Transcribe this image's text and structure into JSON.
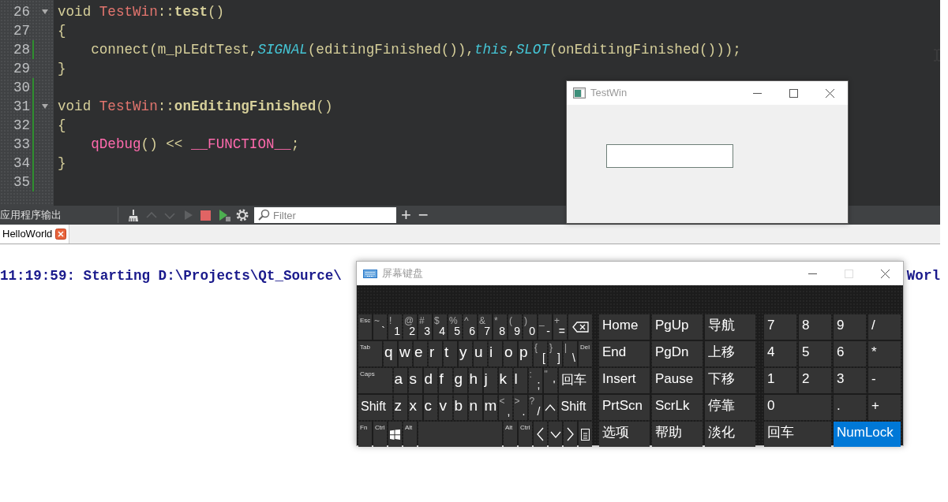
{
  "editor": {
    "lines": [
      {
        "number": "26",
        "foldable": true,
        "changed": false,
        "tokens": [
          {
            "kind": "keyword",
            "text": "void "
          },
          {
            "kind": "class",
            "text": "TestWin"
          },
          {
            "kind": "plain",
            "text": "::"
          },
          {
            "kind": "definition",
            "text": "test"
          },
          {
            "kind": "plain",
            "text": "()"
          }
        ]
      },
      {
        "number": "27",
        "foldable": false,
        "changed": false,
        "tokens": [
          {
            "kind": "plain",
            "text": "{"
          }
        ]
      },
      {
        "number": "28",
        "foldable": false,
        "changed": true,
        "tokens": [
          {
            "kind": "plain",
            "text": "    connect(m_pLEdtTest,"
          },
          {
            "kind": "macro",
            "text": "SIGNAL"
          },
          {
            "kind": "plain",
            "text": "(editingFinished()),"
          },
          {
            "kind": "macro",
            "text": "this"
          },
          {
            "kind": "plain",
            "text": ","
          },
          {
            "kind": "macro",
            "text": "SLOT"
          },
          {
            "kind": "plain",
            "text": "(onEditingFinished()));"
          }
        ]
      },
      {
        "number": "29",
        "foldable": false,
        "changed": false,
        "tokens": [
          {
            "kind": "plain",
            "text": "}"
          }
        ]
      },
      {
        "number": "30",
        "foldable": false,
        "changed": true
      },
      {
        "number": "31",
        "foldable": true,
        "changed": true,
        "tokens": [
          {
            "kind": "keyword",
            "text": "void "
          },
          {
            "kind": "class",
            "text": "TestWin"
          },
          {
            "kind": "plain",
            "text": "::"
          },
          {
            "kind": "definition",
            "text": "onEditingFinished"
          },
          {
            "kind": "plain",
            "text": "()"
          }
        ]
      },
      {
        "number": "32",
        "foldable": false,
        "changed": true,
        "tokens": [
          {
            "kind": "plain",
            "text": "{"
          }
        ]
      },
      {
        "number": "33",
        "foldable": false,
        "changed": true,
        "tokens": [
          {
            "kind": "call",
            "text": "    qDebug"
          },
          {
            "kind": "plain",
            "text": "() << "
          },
          {
            "kind": "call",
            "text": "__FUNCTION__"
          },
          {
            "kind": "plain",
            "text": ";"
          }
        ]
      },
      {
        "number": "34",
        "foldable": false,
        "changed": true,
        "tokens": [
          {
            "kind": "plain",
            "text": "}"
          }
        ]
      },
      {
        "number": "35",
        "foldable": false,
        "changed": true
      }
    ]
  },
  "output_toolbar": {
    "title": "应用程序输出",
    "buttons": [
      {
        "kind": "clean",
        "disabled": false
      },
      {
        "kind": "previous",
        "disabled": true
      },
      {
        "kind": "next",
        "disabled": true
      },
      {
        "kind": "run",
        "disabled": true
      },
      {
        "kind": "stop",
        "disabled": false
      },
      {
        "kind": "rerun",
        "disabled": false
      },
      {
        "kind": "settings",
        "disabled": false
      }
    ],
    "filter": {
      "placeholder": "Filter"
    },
    "zoom_in": "+",
    "zoom_out": "−"
  },
  "output_tabs": [
    {
      "label": "HelloWorld",
      "selected": true
    }
  ],
  "output_line": {
    "visible_start": "11:19:59: Starting D:\\Projects\\Qt_Source\\",
    "visible_end": "Worl"
  },
  "test_window": {
    "title": "TestWin"
  },
  "keyboard_window": {
    "title": "屏幕键盘",
    "maximize_disabled": true,
    "main_rows": [
      [
        {
          "kind": "function",
          "label": "Esc"
        },
        {
          "kind": "symbol",
          "shift": "~",
          "label": "`"
        },
        {
          "kind": "symbol",
          "shift": "!",
          "label": "1"
        },
        {
          "kind": "symbol",
          "shift": "@",
          "label": "2"
        },
        {
          "kind": "symbol",
          "shift": "#",
          "label": "3"
        },
        {
          "kind": "symbol",
          "shift": "$",
          "label": "4"
        },
        {
          "kind": "symbol",
          "shift": "%",
          "label": "5"
        },
        {
          "kind": "symbol",
          "shift": "^",
          "label": "6"
        },
        {
          "kind": "symbol",
          "shift": "&",
          "label": "7"
        },
        {
          "kind": "symbol",
          "shift": "*",
          "label": "8"
        },
        {
          "kind": "symbol",
          "shift": "(",
          "label": "9"
        },
        {
          "kind": "symbol",
          "shift": ")",
          "label": "0"
        },
        {
          "kind": "symbol",
          "shift": "_",
          "label": "-"
        },
        {
          "kind": "symbol",
          "shift": "+",
          "label": "="
        },
        {
          "kind": "backspace",
          "wide": true
        }
      ],
      [
        {
          "kind": "function",
          "label": "Tab",
          "wide": true
        },
        {
          "kind": "letter",
          "label": "q"
        },
        {
          "kind": "letter",
          "label": "w"
        },
        {
          "kind": "letter",
          "label": "e"
        },
        {
          "kind": "letter",
          "label": "r"
        },
        {
          "kind": "letter",
          "label": "t"
        },
        {
          "kind": "letter",
          "label": "y"
        },
        {
          "kind": "letter",
          "label": "u"
        },
        {
          "kind": "letter",
          "label": "i"
        },
        {
          "kind": "letter",
          "label": "o"
        },
        {
          "kind": "letter",
          "label": "p"
        },
        {
          "kind": "symbol",
          "shift": "{",
          "label": "["
        },
        {
          "kind": "symbol",
          "shift": "}",
          "label": "]"
        },
        {
          "kind": "symbol",
          "shift": "|",
          "label": "\\"
        },
        {
          "kind": "function",
          "label": "Del"
        }
      ],
      [
        {
          "kind": "function",
          "label": "Caps",
          "wide": true
        },
        {
          "kind": "letter",
          "label": "a"
        },
        {
          "kind": "letter",
          "label": "s"
        },
        {
          "kind": "letter",
          "label": "d"
        },
        {
          "kind": "letter",
          "label": "f"
        },
        {
          "kind": "letter",
          "label": "g"
        },
        {
          "kind": "letter",
          "label": "h"
        },
        {
          "kind": "letter",
          "label": "j"
        },
        {
          "kind": "letter",
          "label": "k"
        },
        {
          "kind": "letter",
          "label": "l"
        },
        {
          "kind": "symbol",
          "shift": ":",
          "label": ";"
        },
        {
          "kind": "symbol",
          "shift": "\"",
          "label": "'"
        },
        {
          "kind": "word",
          "label": "回车",
          "wide": true
        }
      ],
      [
        {
          "kind": "word",
          "label": "Shift",
          "wide": true
        },
        {
          "kind": "letter",
          "label": "z"
        },
        {
          "kind": "letter",
          "label": "x"
        },
        {
          "kind": "letter",
          "label": "c"
        },
        {
          "kind": "letter",
          "label": "v"
        },
        {
          "kind": "letter",
          "label": "b"
        },
        {
          "kind": "letter",
          "label": "n"
        },
        {
          "kind": "letter",
          "label": "m"
        },
        {
          "kind": "symbol",
          "shift": "<",
          "label": ","
        },
        {
          "kind": "symbol",
          "shift": ">",
          "label": "."
        },
        {
          "kind": "symbol",
          "shift": "?",
          "label": "/"
        },
        {
          "kind": "arrow-up"
        },
        {
          "kind": "word",
          "label": "Shift",
          "wide": true
        }
      ],
      [
        {
          "kind": "function",
          "label": "Fn"
        },
        {
          "kind": "function",
          "label": "Ctrl"
        },
        {
          "kind": "windows"
        },
        {
          "kind": "function",
          "label": "Alt"
        },
        {
          "kind": "space",
          "wide": true
        },
        {
          "kind": "function",
          "label": "Alt"
        },
        {
          "kind": "function",
          "label": "Ctrl"
        },
        {
          "kind": "arrow-left"
        },
        {
          "kind": "arrow-down"
        },
        {
          "kind": "arrow-right"
        },
        {
          "kind": "menu"
        }
      ]
    ],
    "nav_keys": [
      {
        "label": "Home"
      },
      {
        "label": "PgUp"
      },
      {
        "label": "导航"
      },
      {
        "label": "End"
      },
      {
        "label": "PgDn"
      },
      {
        "label": "上移"
      },
      {
        "label": "Insert"
      },
      {
        "label": "Pause"
      },
      {
        "label": "下移"
      },
      {
        "label": "PrtScn"
      },
      {
        "label": "ScrLk"
      },
      {
        "label": "停靠"
      },
      {
        "label": "选项"
      },
      {
        "label": "帮助"
      },
      {
        "label": "淡化"
      }
    ],
    "numpad_keys": [
      {
        "label": "7",
        "on": false
      },
      {
        "label": "8",
        "on": false
      },
      {
        "label": "9",
        "on": false
      },
      {
        "label": "/",
        "on": false
      },
      {
        "label": "4",
        "on": false
      },
      {
        "label": "5",
        "on": false
      },
      {
        "label": "6",
        "on": false
      },
      {
        "label": "*",
        "on": false
      },
      {
        "label": "1",
        "on": false
      },
      {
        "label": "2",
        "on": false
      },
      {
        "label": "3",
        "on": false
      },
      {
        "label": "-",
        "on": false
      },
      {
        "label": "0",
        "on": false,
        "wide": true
      },
      {
        "label": ".",
        "on": false
      },
      {
        "label": "+",
        "on": false
      },
      {
        "label": "回车",
        "on": false,
        "wide": true
      },
      {
        "label": "NumLock",
        "on": true,
        "wide": true
      }
    ]
  }
}
